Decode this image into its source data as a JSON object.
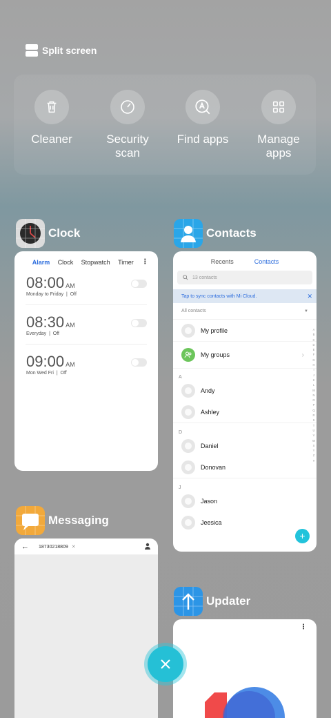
{
  "split_screen": {
    "label": "Split screen"
  },
  "quick_actions": [
    {
      "label": "Cleaner",
      "icon": "trash-icon"
    },
    {
      "label": "Security\nscan",
      "icon": "security-gauge-icon"
    },
    {
      "label": "Find apps",
      "icon": "find-apps-icon"
    },
    {
      "label": "Manage\napps",
      "icon": "grid-icon"
    }
  ],
  "clock": {
    "title": "Clock",
    "tabs": [
      "Alarm",
      "Clock",
      "Stopwatch",
      "Timer"
    ],
    "alarms": [
      {
        "time": "08:00",
        "ampm": "AM",
        "repeat": "Monday to Friday",
        "status": "Off"
      },
      {
        "time": "08:30",
        "ampm": "AM",
        "repeat": "Everyday",
        "status": "Off"
      },
      {
        "time": "09:00",
        "ampm": "AM",
        "repeat": "Mon Wed Fri",
        "status": "Off"
      }
    ]
  },
  "contacts": {
    "title": "Contacts",
    "tabs": [
      "Recents",
      "Contacts"
    ],
    "search_placeholder": "13 contacts",
    "sync_banner": "Tap to sync contacts with Mi Cloud.",
    "all_contacts": "All contacts",
    "my_profile": "My profile",
    "my_groups": "My groups",
    "sections": [
      {
        "letter": "A",
        "names": [
          "Andy",
          "Ashley"
        ]
      },
      {
        "letter": "D",
        "names": [
          "Daniel",
          "Donovan"
        ]
      },
      {
        "letter": "J",
        "names": [
          "Jason",
          "Jeesica"
        ]
      }
    ],
    "alphabet": [
      "A",
      "B",
      "C",
      "D",
      "E",
      "F",
      "G",
      "H",
      "I",
      "J",
      "K",
      "L",
      "M",
      "N",
      "O",
      "P",
      "Q",
      "R",
      "S",
      "T",
      "U",
      "V",
      "W",
      "X",
      "Y",
      "Z",
      "#"
    ]
  },
  "messaging": {
    "title": "Messaging",
    "recipient": "18730218809"
  },
  "updater": {
    "title": "Updater"
  },
  "colors": {
    "accent": "#25c0d6",
    "link": "#2b6cdd"
  }
}
